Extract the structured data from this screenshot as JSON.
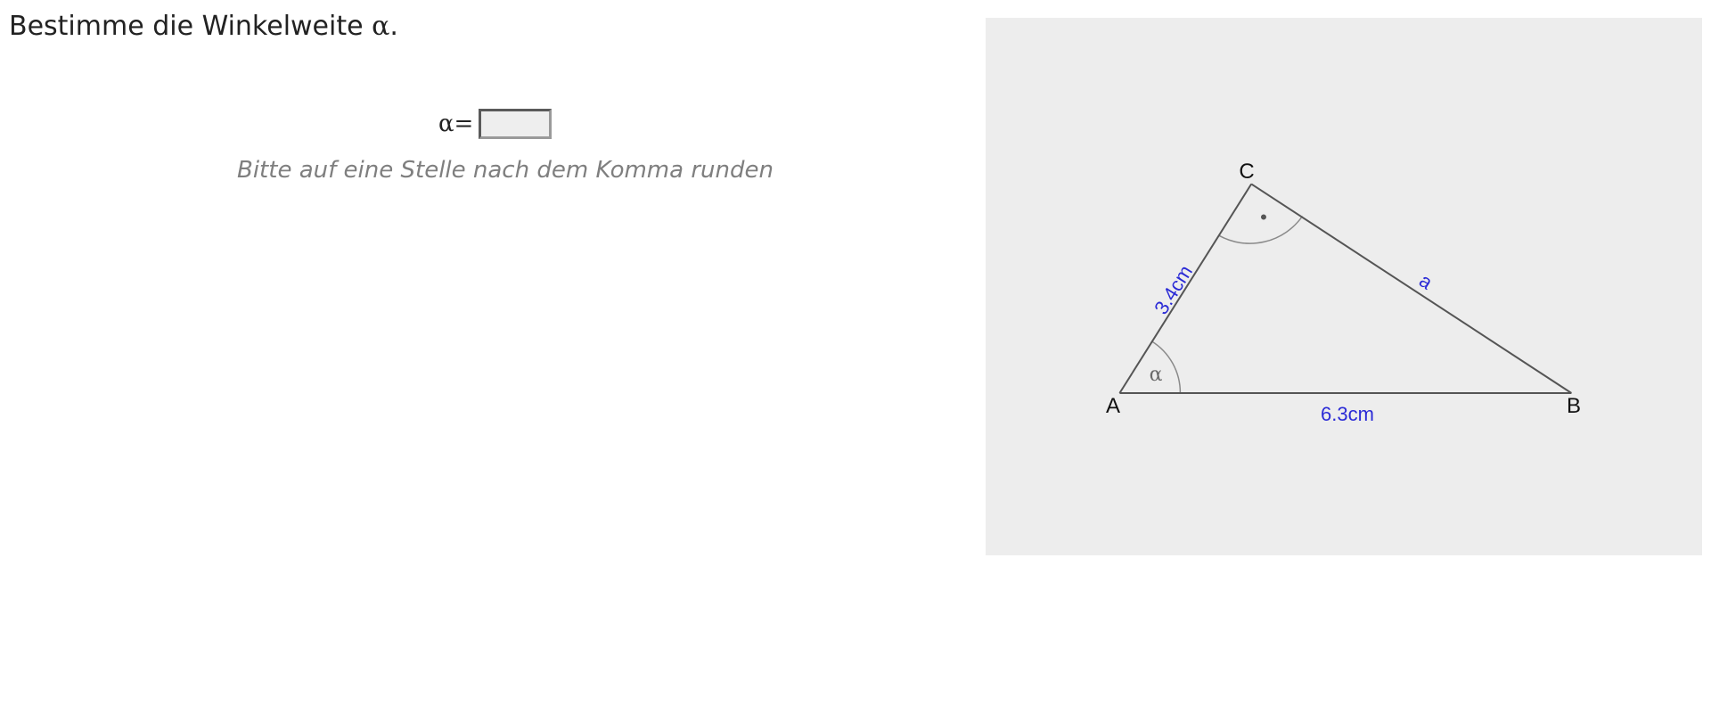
{
  "task": {
    "title_prefix": "Bestimme die Winkelweite ",
    "title_symbol": "α",
    "title_suffix": "."
  },
  "answer": {
    "label": "α=",
    "value": "",
    "placeholder": "",
    "hint": "Bitte auf eine Stelle nach dem Komma runden"
  },
  "figure": {
    "vertex_a": "A",
    "vertex_b": "B",
    "vertex_c": "C",
    "side_ac": "3.4cm",
    "side_ab": "6.3cm",
    "side_bc": "a",
    "angle_alpha": "α",
    "right_angle_mark": "•",
    "colors": {
      "panel_background": "#ededed",
      "edge": "#555555",
      "arc": "#8a8a8a",
      "side_label": "#2b2bd6",
      "vertex_label": "#111111"
    }
  }
}
